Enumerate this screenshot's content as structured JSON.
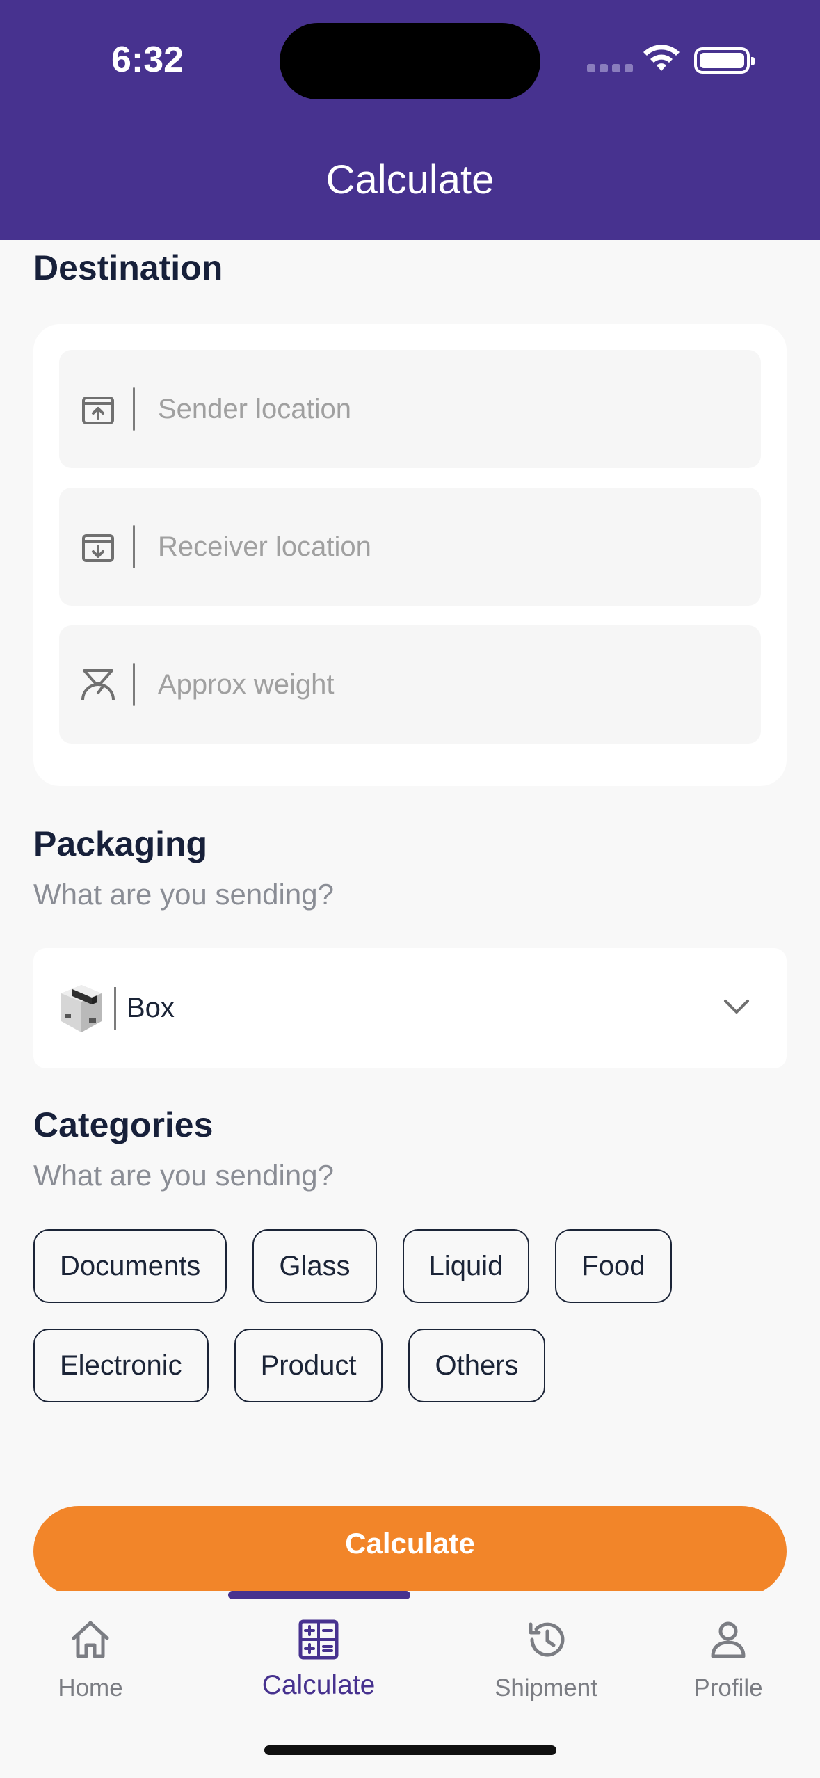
{
  "status_bar": {
    "time": "6:32"
  },
  "header": {
    "title": "Calculate"
  },
  "destination": {
    "title": "Destination",
    "fields": [
      {
        "placeholder": "Sender location",
        "icon": "upload-box-icon"
      },
      {
        "placeholder": "Receiver location",
        "icon": "download-box-icon"
      },
      {
        "placeholder": "Approx weight",
        "icon": "scale-icon"
      }
    ]
  },
  "packaging": {
    "title": "Packaging",
    "subtitle": "What are you sending?",
    "selected": "Box",
    "icon": "box-icon"
  },
  "categories": {
    "title": "Categories",
    "subtitle": "What are you sending?",
    "items": [
      "Documents",
      "Glass",
      "Liquid",
      "Food",
      "Electronic",
      "Product",
      "Others"
    ]
  },
  "action": {
    "calculate_label": "Calculate"
  },
  "tabs": [
    {
      "label": "Home",
      "icon": "home-icon"
    },
    {
      "label": "Calculate",
      "icon": "calculator-icon",
      "active": true
    },
    {
      "label": "Shipment",
      "icon": "history-icon"
    },
    {
      "label": "Profile",
      "icon": "profile-icon"
    }
  ],
  "colors": {
    "primary": "#47328f",
    "accent": "#f28529"
  }
}
